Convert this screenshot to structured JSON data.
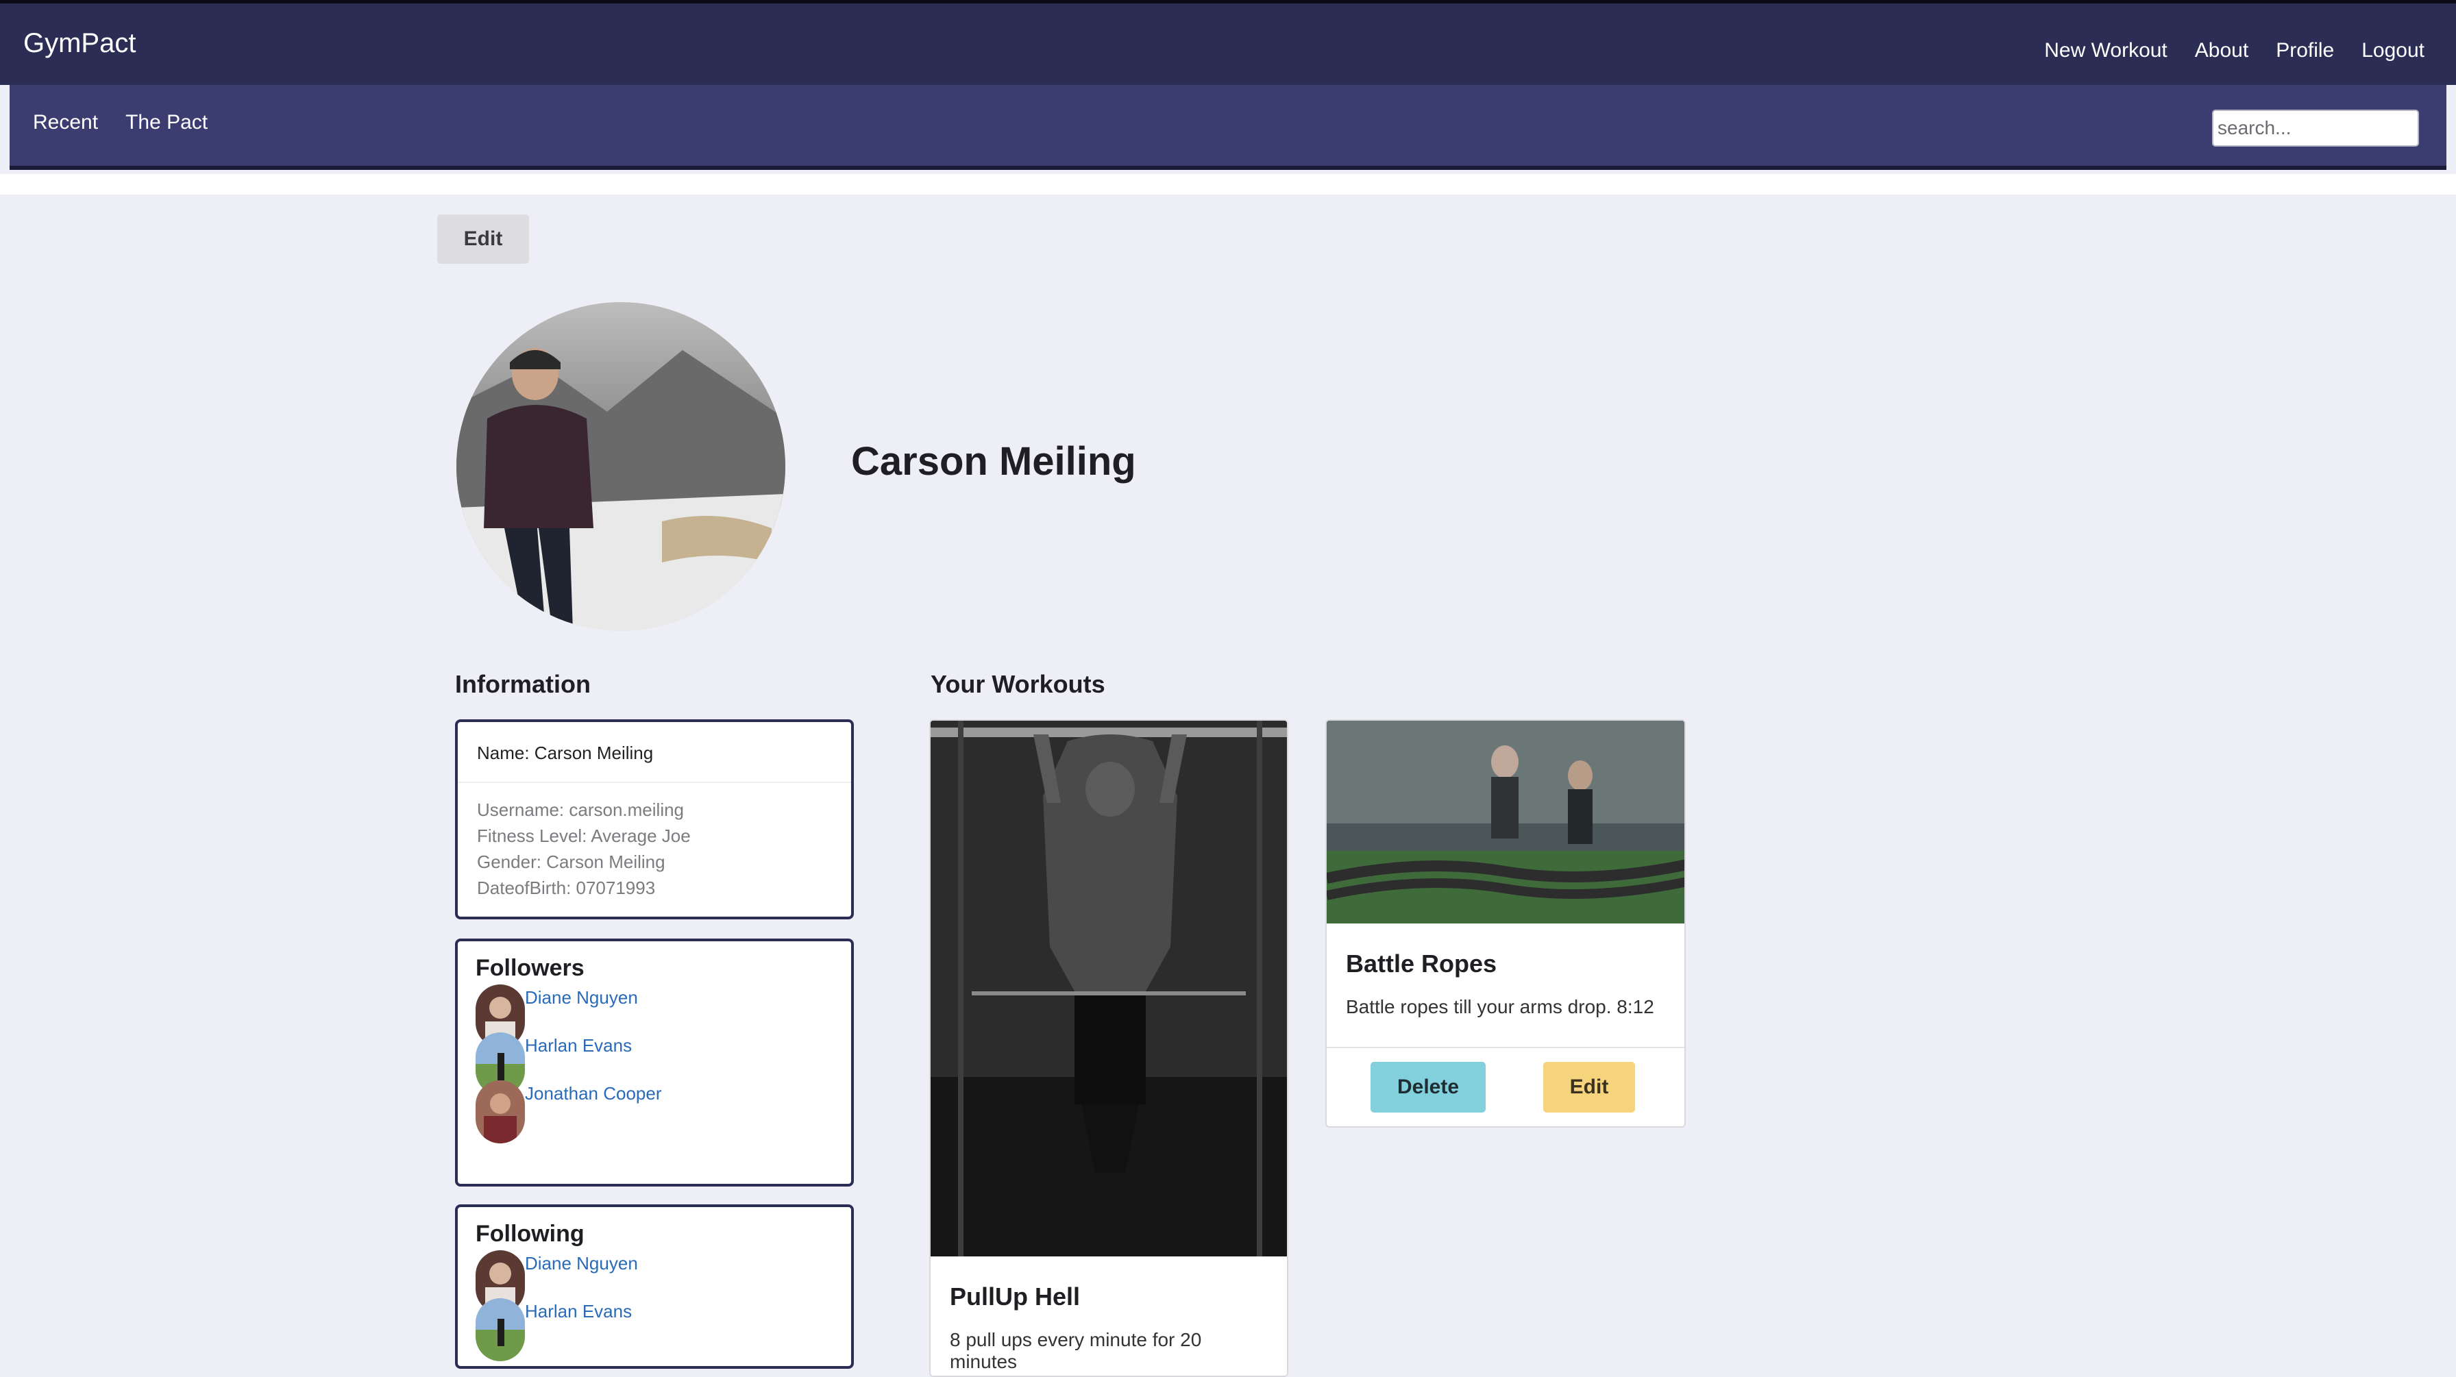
{
  "app": {
    "brand": "GymPact"
  },
  "top_nav": [
    "New Workout",
    "About",
    "Profile",
    "Logout"
  ],
  "sub_nav": [
    "Recent",
    "The Pact"
  ],
  "search": {
    "placeholder": "search..."
  },
  "profile": {
    "edit_label": "Edit",
    "name": "Carson Meiling"
  },
  "information": {
    "title": "Information",
    "name_line": "Name: Carson Meiling",
    "lines": [
      "Username: carson.meiling",
      "Fitness Level: Average Joe",
      "Gender: Carson Meiling",
      "DateofBirth: 07071993"
    ]
  },
  "followers": {
    "title": "Followers",
    "people": [
      "Diane Nguyen",
      "Harlan Evans",
      "Jonathan Cooper"
    ]
  },
  "following": {
    "title": "Following",
    "people": [
      "Diane Nguyen",
      "Harlan Evans"
    ]
  },
  "workouts": {
    "title": "Your Workouts",
    "items": [
      {
        "title": "PullUp Hell",
        "description": "8 pull ups every minute for 20 minutes"
      },
      {
        "title": "Battle Ropes",
        "description": "Battle ropes till your arms drop. 8:12",
        "delete_label": "Delete",
        "edit_label": "Edit"
      }
    ]
  }
}
